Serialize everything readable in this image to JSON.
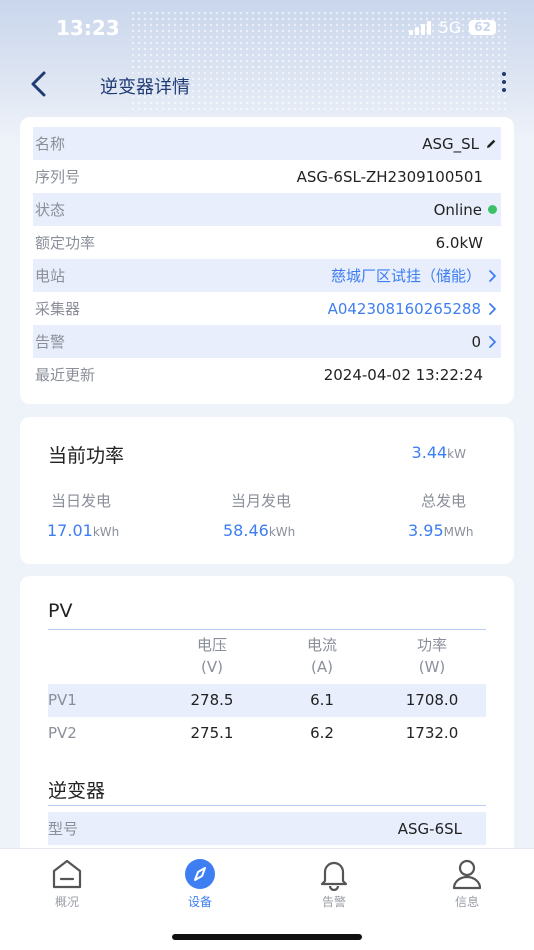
{
  "status_bar": {
    "time": "13:23",
    "network": "5G",
    "battery": "62"
  },
  "nav": {
    "title": "逆变器详情"
  },
  "info": {
    "rows": [
      {
        "label": "名称",
        "value": "ASG_SL"
      },
      {
        "label": "序列号",
        "value": "ASG-6SL-ZH2309100501"
      },
      {
        "label": "状态",
        "value": "Online"
      },
      {
        "label": "额定功率",
        "value": "6.0kW"
      },
      {
        "label": "电站",
        "value": "慈城厂区试挂（储能）"
      },
      {
        "label": "采集器",
        "value": "A042308160265288"
      },
      {
        "label": "告警",
        "value": "0"
      },
      {
        "label": "最近更新",
        "value": "2024-04-02 13:22:24"
      }
    ]
  },
  "power": {
    "title": "当前功率",
    "current_value": "3.44",
    "current_unit": "kW",
    "stats": [
      {
        "label": "当日发电",
        "value": "17.01",
        "unit": "kWh"
      },
      {
        "label": "当月发电",
        "value": "58.46",
        "unit": "kWh"
      },
      {
        "label": "总发电",
        "value": "3.95",
        "unit": "MWh"
      }
    ]
  },
  "pv": {
    "title": "PV",
    "headers": [
      {
        "name": "电压",
        "unit": "(V)"
      },
      {
        "name": "电流",
        "unit": "(A)"
      },
      {
        "name": "功率",
        "unit": "(W)"
      }
    ],
    "rows": [
      {
        "name": "PV1",
        "voltage": "278.5",
        "current": "6.1",
        "power": "1708.0"
      },
      {
        "name": "PV2",
        "voltage": "275.1",
        "current": "6.2",
        "power": "1732.0"
      }
    ]
  },
  "inverter": {
    "title": "逆变器",
    "model_label": "型号",
    "model_value": "ASG-6SL"
  },
  "tabs": [
    {
      "label": "概况"
    },
    {
      "label": "设备"
    },
    {
      "label": "告警"
    },
    {
      "label": "信息"
    }
  ],
  "colors": {
    "accent": "#3e7ef3",
    "online": "#3cc06a",
    "nav_text": "#1f3b74"
  }
}
